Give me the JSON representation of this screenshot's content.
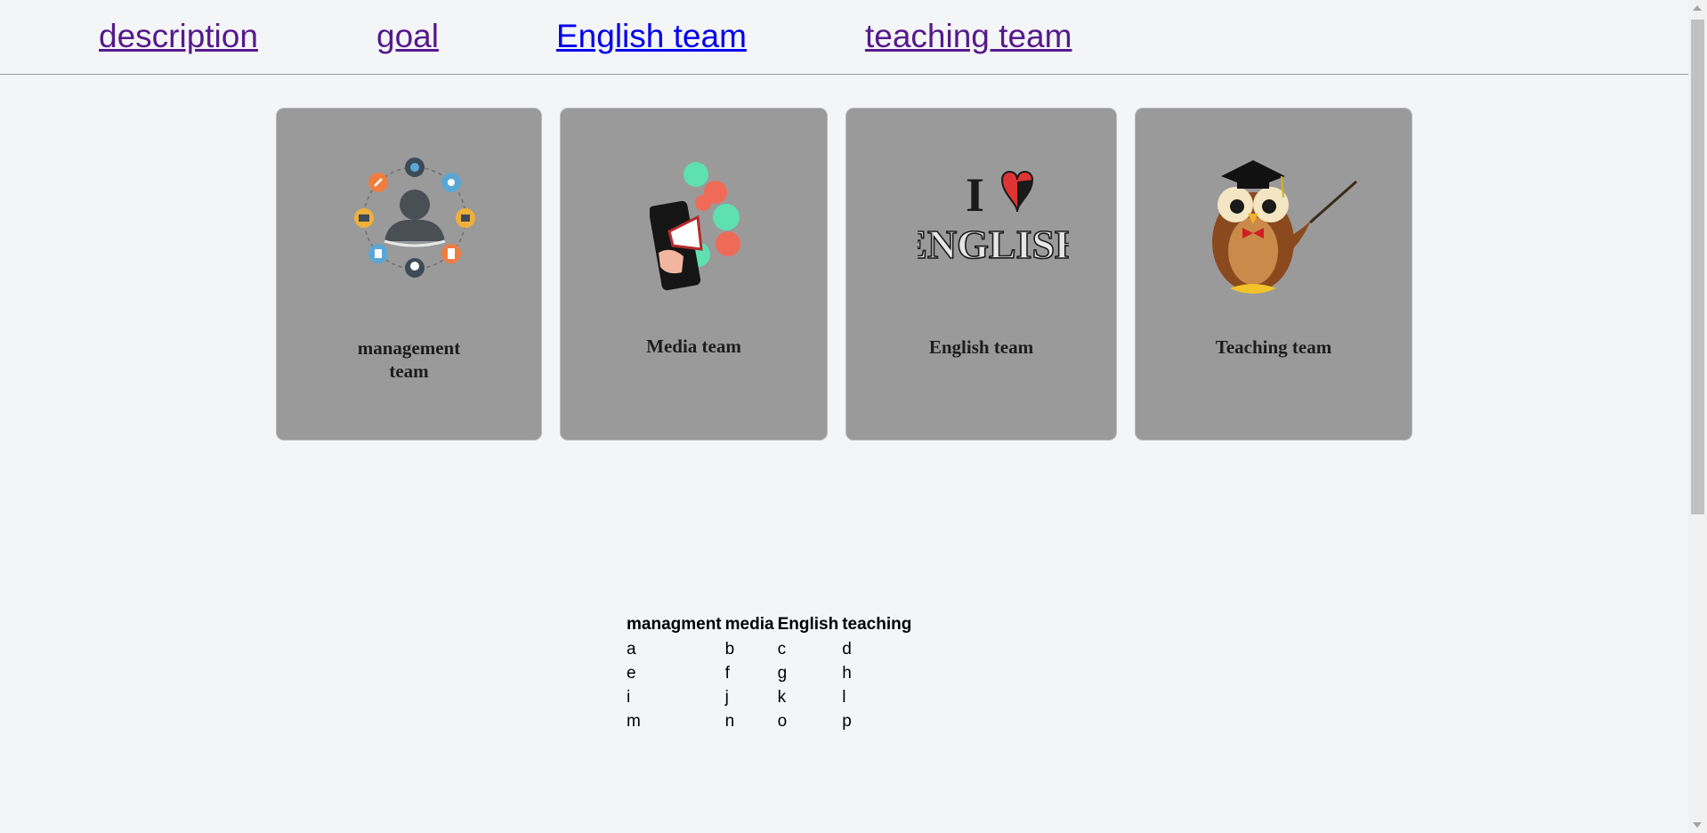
{
  "nav": {
    "links": [
      {
        "label": "description"
      },
      {
        "label": "goal"
      },
      {
        "label": "English team"
      },
      {
        "label": "teaching team"
      }
    ]
  },
  "cards": [
    {
      "caption": "management team",
      "icon": "management-team-icon"
    },
    {
      "caption": "Media team",
      "icon": "megaphone-icon"
    },
    {
      "caption": "English team",
      "icon": "i-love-english-icon"
    },
    {
      "caption": "Teaching team",
      "icon": "owl-teacher-icon"
    }
  ],
  "english_logo": {
    "letter": "I",
    "word": "ENGLISH"
  },
  "table": {
    "headers": [
      "managment",
      "media",
      "English",
      "teaching"
    ],
    "rows": [
      [
        "a",
        "b",
        "c",
        "d"
      ],
      [
        "e",
        "f",
        "g",
        "h"
      ],
      [
        "i",
        "j",
        "k",
        "l"
      ],
      [
        "m",
        "n",
        "o",
        "p"
      ]
    ]
  },
  "colors": {
    "link_visited": "#551a8b",
    "link_unvisited": "#0000ee",
    "card_bg": "#9a9a9a",
    "page_bg": "#f4f5f7"
  }
}
